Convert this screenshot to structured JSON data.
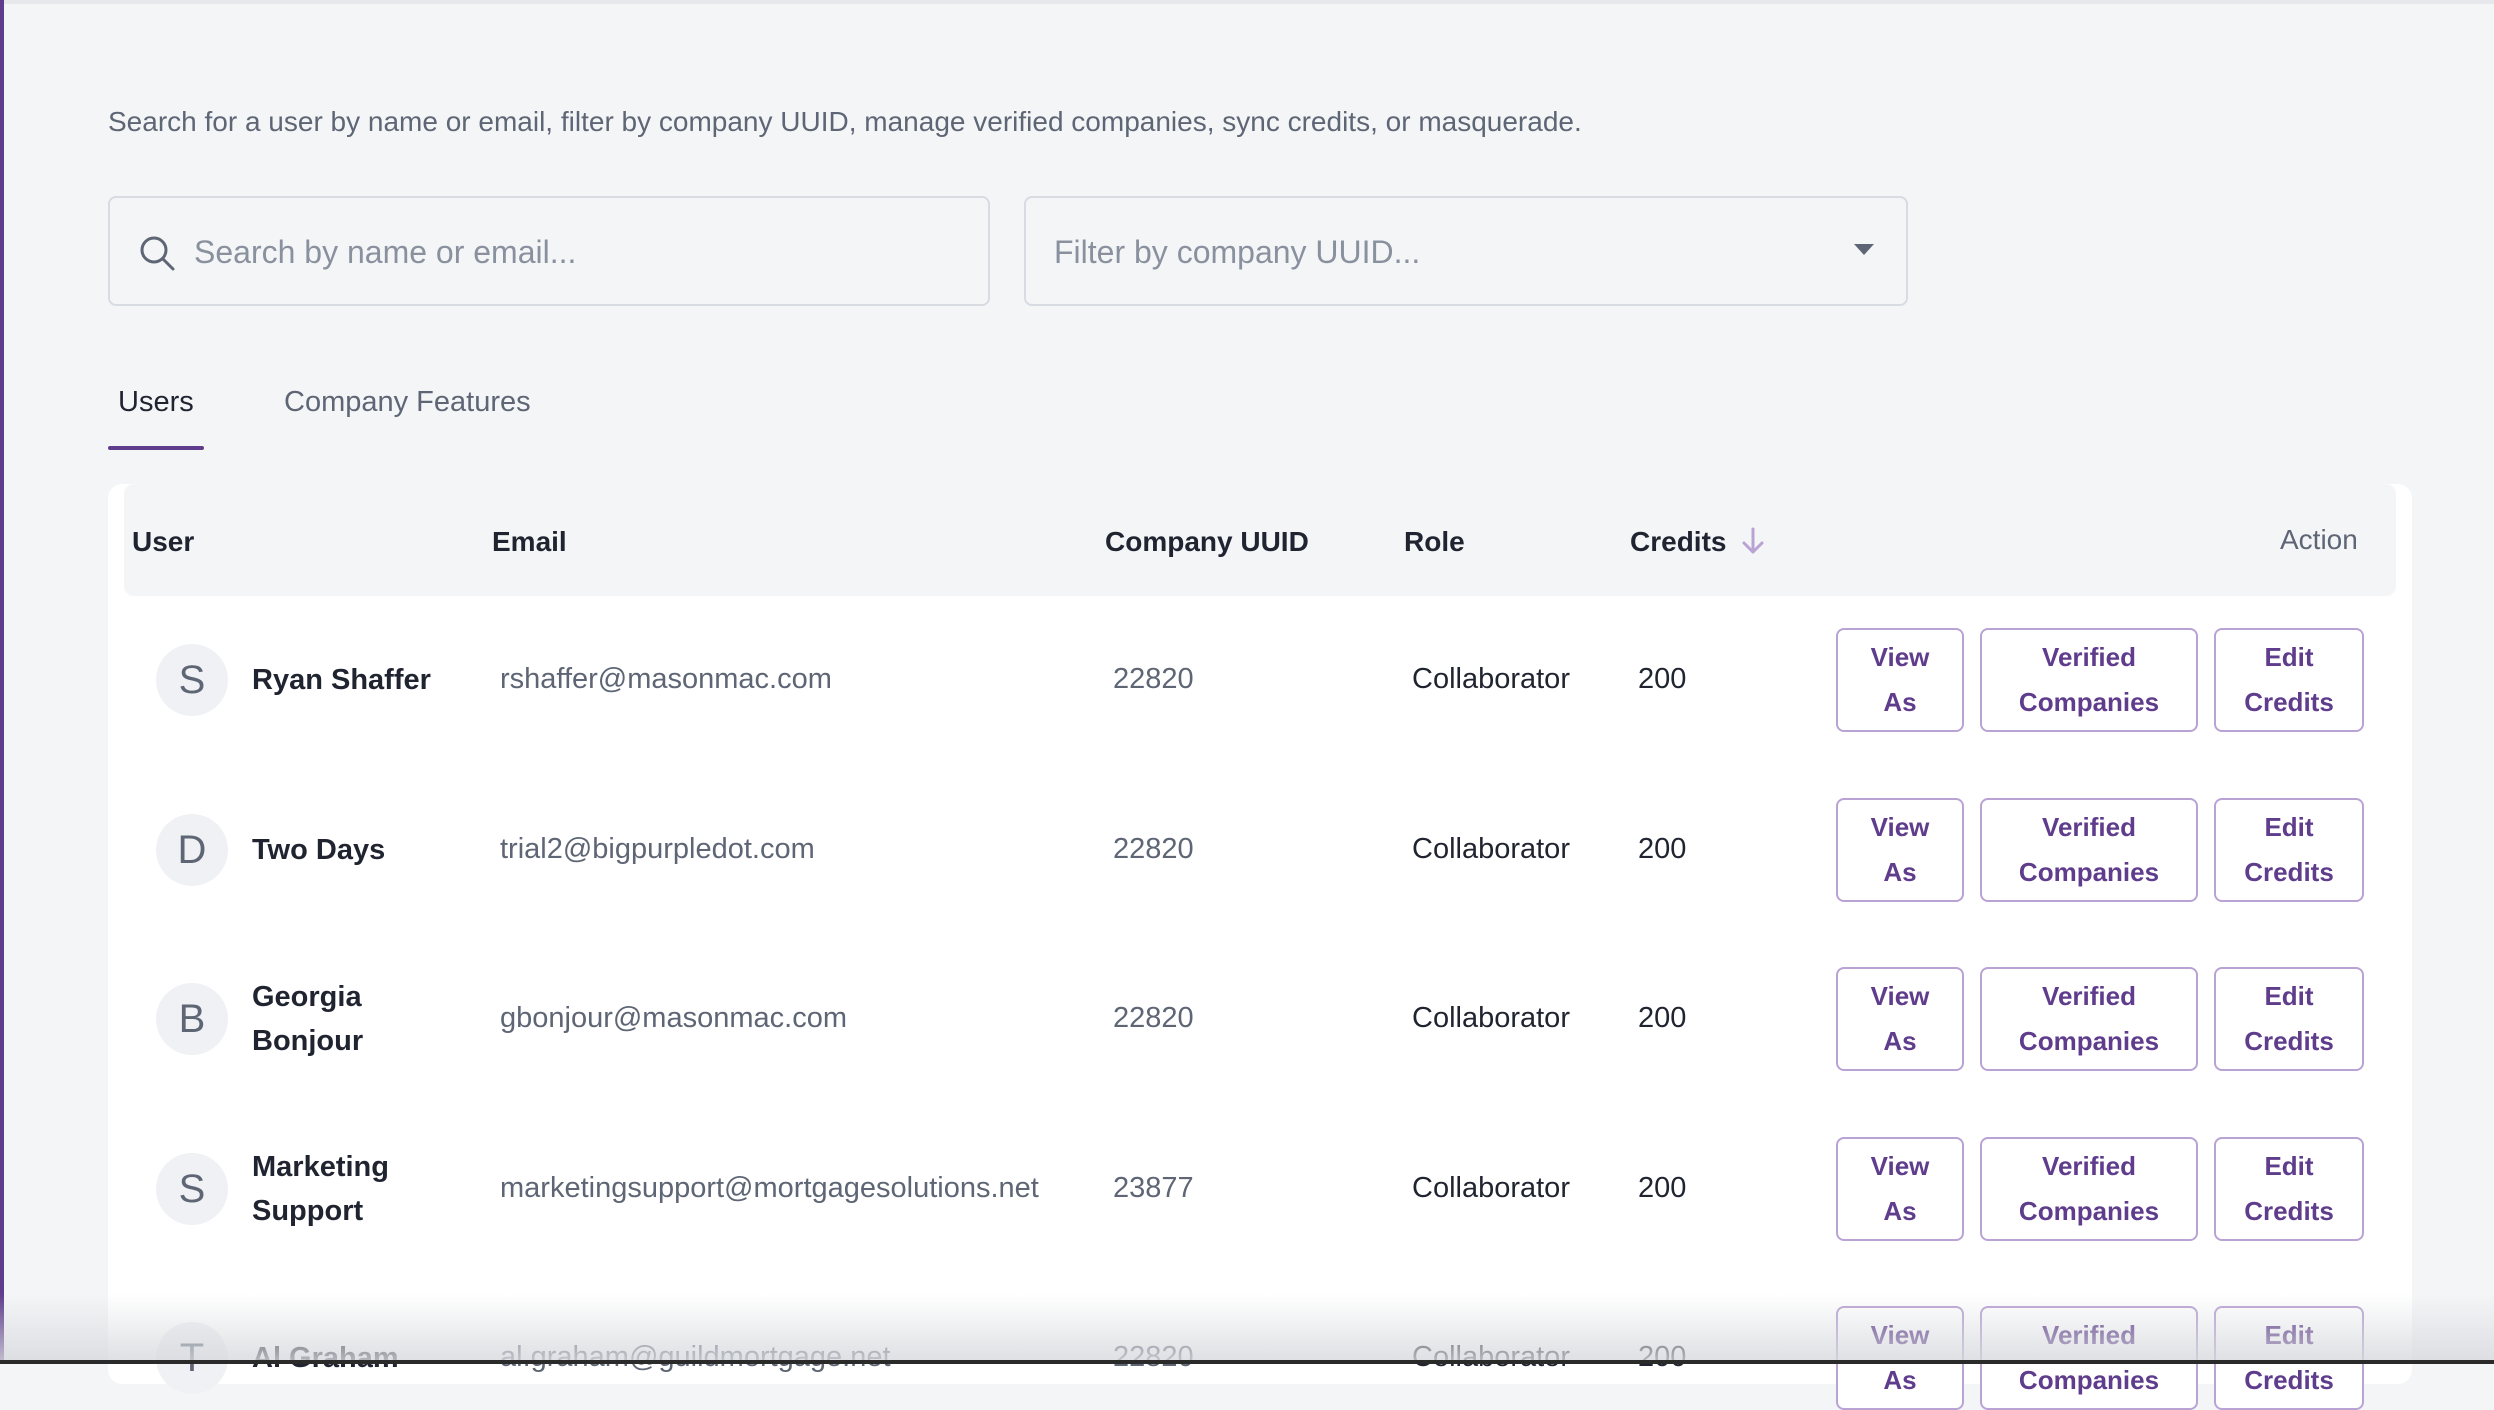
{
  "description": "Search for a user by name or email, filter by company UUID, manage verified companies, sync credits, or masquerade.",
  "search": {
    "placeholder": "Search by name or email..."
  },
  "filter": {
    "placeholder": "Filter by company UUID..."
  },
  "tabs": [
    {
      "label": "Users",
      "active": true
    },
    {
      "label": "Company Features",
      "active": false
    }
  ],
  "table": {
    "headers": {
      "user": "User",
      "email": "Email",
      "company_uuid": "Company UUID",
      "role": "Role",
      "credits": "Credits",
      "action": "Action"
    },
    "sort": {
      "column": "credits",
      "direction": "descending",
      "icon": "arrow-down-icon"
    },
    "actions": {
      "view_as": [
        "View",
        "As"
      ],
      "verified_companies": [
        "Verified",
        "Companies"
      ],
      "edit_credits": [
        "Edit",
        "Credits"
      ]
    },
    "rows": [
      {
        "initial": "S",
        "name_lines": [
          "Ryan Shaffer"
        ],
        "email": "rshaffer@masonmac.com",
        "company_uuid": "22820",
        "role": "Collaborator",
        "credits": "200"
      },
      {
        "initial": "D",
        "name_lines": [
          "Two Days"
        ],
        "email": "trial2@bigpurpledot.com",
        "company_uuid": "22820",
        "role": "Collaborator",
        "credits": "200"
      },
      {
        "initial": "B",
        "name_lines": [
          "Georgia",
          "Bonjour"
        ],
        "email": "gbonjour@masonmac.com",
        "company_uuid": "22820",
        "role": "Collaborator",
        "credits": "200"
      },
      {
        "initial": "S",
        "name_lines": [
          "Marketing",
          "Support"
        ],
        "email": "marketingsupport@mortgagesolutions.net",
        "company_uuid": "23877",
        "role": "Collaborator",
        "credits": "200"
      },
      {
        "initial": "T",
        "name_lines": [
          "Al Graham"
        ],
        "email": "al.graham@guildmortgage.net",
        "company_uuid": "22820",
        "role": "Collaborator",
        "credits": "200"
      }
    ]
  },
  "colors": {
    "accent": "#5f3d8c",
    "button_border": "#b9a3d4",
    "muted_text": "#5e6675"
  }
}
